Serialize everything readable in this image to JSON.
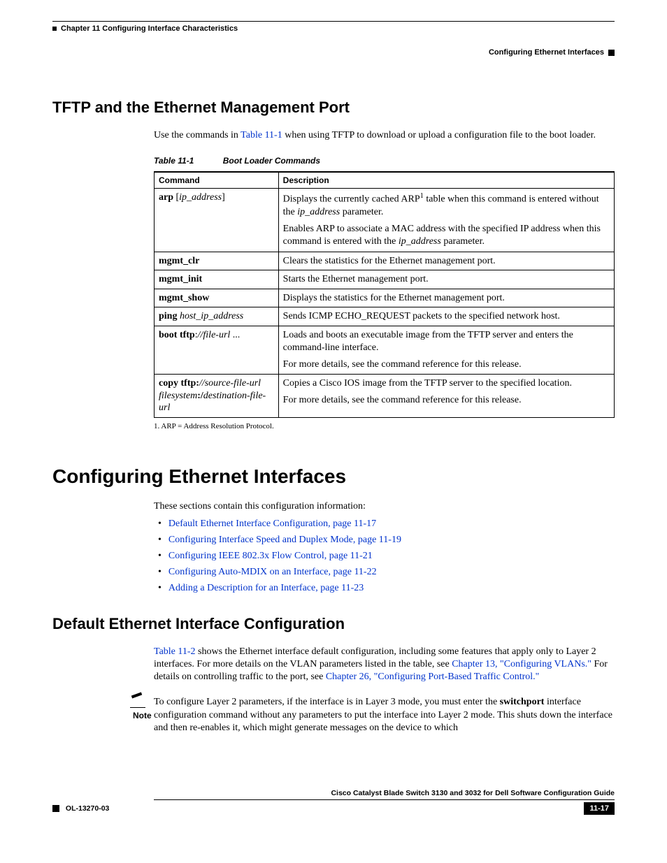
{
  "header": {
    "chapter": "Chapter 11    Configuring Interface Characteristics",
    "section": "Configuring Ethernet Interfaces"
  },
  "tftp": {
    "heading": "TFTP and the Ethernet Management Port",
    "intro_a": "Use the commands in ",
    "intro_link": "Table 11-1",
    "intro_b": " when using TFTP to download or upload a configuration file to the boot loader.",
    "table_caption_num": "Table 11-1",
    "table_caption_title": "Boot Loader Commands",
    "th_cmd": "Command",
    "th_desc": "Description",
    "rows": [
      {
        "cmd_html": "<b>arp</b> [<i>ip_address</i>]",
        "desc_html": "<p>Displays the currently cached ARP<sup>1</sup> table when this command is entered without the <i>ip_address</i> parameter.</p><p>Enables ARP to associate a MAC address with the specified IP address when this command is entered with the <i>ip_address</i> parameter.</p>"
      },
      {
        "cmd_html": "<b>mgmt_clr</b>",
        "desc_html": "Clears the statistics for the Ethernet management port."
      },
      {
        "cmd_html": "<b>mgmt_init</b>",
        "desc_html": "Starts the Ethernet management port."
      },
      {
        "cmd_html": "<b>mgmt_show</b>",
        "desc_html": "Displays the statistics for the Ethernet management port."
      },
      {
        "cmd_html": "<b>ping</b> <i>host_ip_address</i>",
        "desc_html": "Sends ICMP ECHO_REQUEST packets to the specified network host."
      },
      {
        "cmd_html": "<b>boot tftp</b>:<i>//file-url</i> ...",
        "desc_html": "<p>Loads and boots an executable image from the TFTP server and enters the command-line interface.</p><p>For more details, see the command reference for this release.</p>"
      },
      {
        "cmd_html": "<b>copy tftp:</b><i>//source-file-url filesystem</i><b>:/</b><i>destination-file-url</i>",
        "desc_html": "<p>Copies a Cisco IOS image from the TFTP server to the specified location.</p><p>For more details, see the command reference for this release.</p>"
      }
    ],
    "footnote": "1.  ARP = Address Resolution Protocol."
  },
  "configuring": {
    "heading": "Configuring Ethernet Interfaces",
    "intro": "These sections contain this configuration information:",
    "links": [
      "Default Ethernet Interface Configuration, page 11-17",
      "Configuring Interface Speed and Duplex Mode, page 11-19",
      "Configuring IEEE 802.3x Flow Control, page 11-21",
      "Configuring Auto-MDIX on an Interface, page 11-22",
      "Adding a Description for an Interface, page 11-23"
    ]
  },
  "defaultcfg": {
    "heading": "Default Ethernet Interface Configuration",
    "p1_link1": "Table 11-2",
    "p1_a": " shows the Ethernet interface default configuration, including some features that apply only to Layer 2 interfaces. For more details on the VLAN parameters listed in the table, see ",
    "p1_link2": "Chapter 13, \"Configuring VLANs.\"",
    "p1_b": " For details on controlling traffic to the port, see ",
    "p1_link3": "Chapter 26, \"Configuring Port-Based Traffic Control.\"",
    "note_label": "Note",
    "note_a": "To configure Layer 2 parameters, if the interface is in Layer 3 mode, you must enter the ",
    "note_b": "switchport",
    "note_c": " interface configuration command without any parameters to put the interface into Layer 2 mode. This shuts down the interface and then re-enables it, which might generate messages on the device to which"
  },
  "footer": {
    "guide": "Cisco Catalyst Blade Switch 3130 and 3032 for Dell Software Configuration Guide",
    "doc_id": "OL-13270-03",
    "page": "11-17"
  }
}
